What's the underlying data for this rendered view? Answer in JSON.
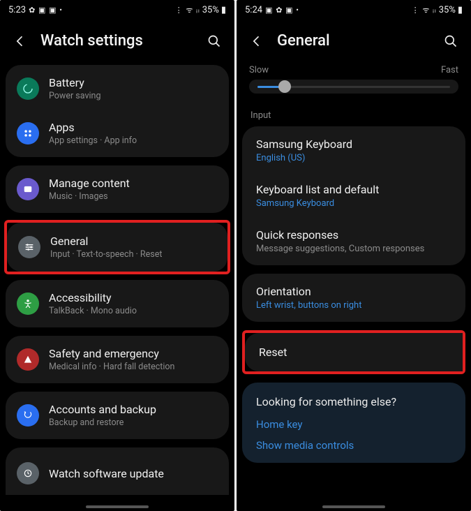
{
  "left": {
    "status": {
      "time": "5:23",
      "battery": "35%"
    },
    "header": {
      "title": "Watch settings"
    },
    "items": {
      "battery": {
        "title": "Battery",
        "sub": "Power saving"
      },
      "apps": {
        "title": "Apps",
        "sub": "App settings · App info"
      },
      "content": {
        "title": "Manage content",
        "sub": "Music · Images"
      },
      "general": {
        "title": "General",
        "sub": "Input · Text-to-speech · Reset"
      },
      "access": {
        "title": "Accessibility",
        "sub": "TalkBack · Mono audio"
      },
      "safety": {
        "title": "Safety and emergency",
        "sub": "Medical info · Hard fall detection"
      },
      "backup": {
        "title": "Accounts and backup",
        "sub": "Backup and restore"
      },
      "update": {
        "title": "Watch software update"
      }
    }
  },
  "right": {
    "status": {
      "time": "5:24",
      "battery": "35%"
    },
    "header": {
      "title": "General"
    },
    "slider": {
      "slow": "Slow",
      "fast": "Fast"
    },
    "section_input": "Input",
    "items": {
      "kb": {
        "title": "Samsung Keyboard",
        "sub": "English (US)"
      },
      "kblist": {
        "title": "Keyboard list and default",
        "sub": "Samsung Keyboard"
      },
      "quick": {
        "title": "Quick responses",
        "sub": "Message suggestions, Custom responses"
      },
      "orient": {
        "title": "Orientation",
        "sub": "Left wrist, buttons on right"
      },
      "reset": {
        "title": "Reset"
      }
    },
    "suggest": {
      "title": "Looking for something else?",
      "link1": "Home key",
      "link2": "Show media controls"
    }
  }
}
